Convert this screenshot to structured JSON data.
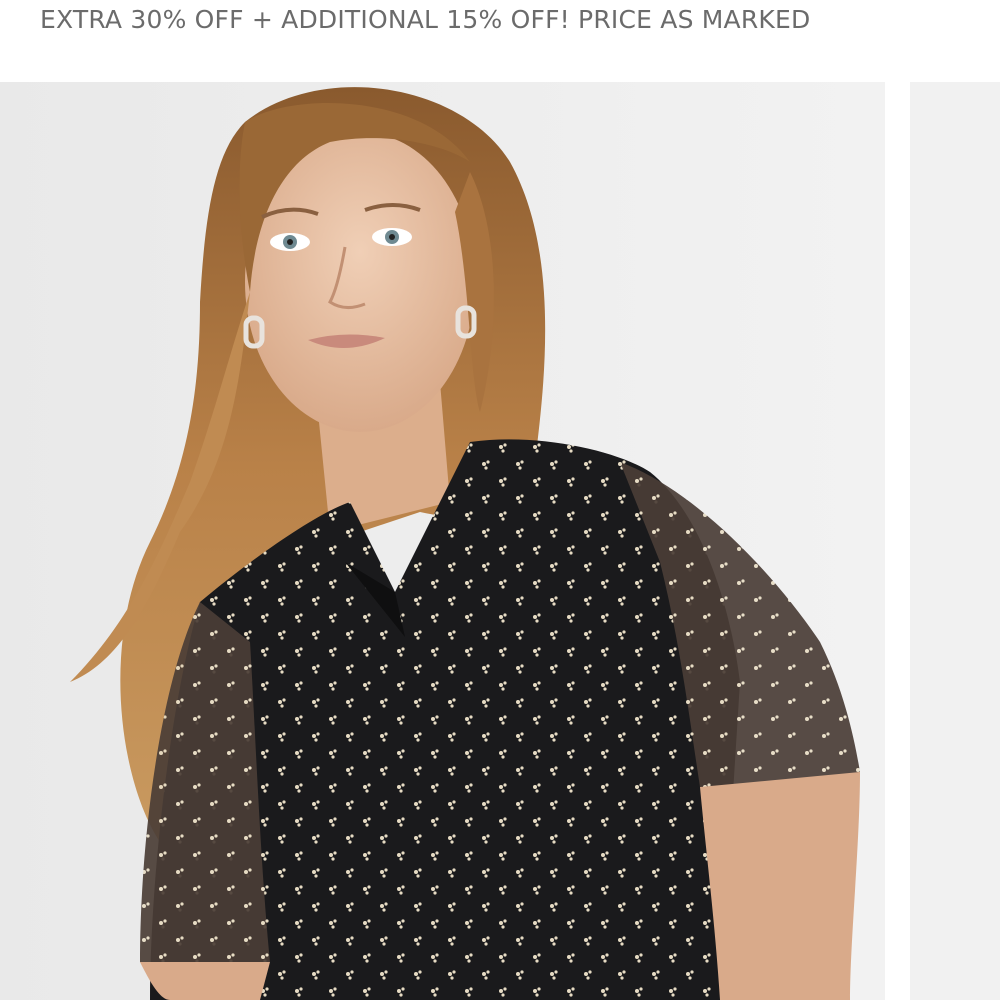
{
  "promo": {
    "text": "EXTRA 30% OFF + ADDITIONAL 15% OFF! PRICE AS MARKED"
  },
  "colors": {
    "promo_text": "#6b6b6b",
    "photo_background": "#ececec",
    "garment": "#1a1a1c",
    "hair": "#b07a45",
    "skin": "#e8c3a6"
  }
}
